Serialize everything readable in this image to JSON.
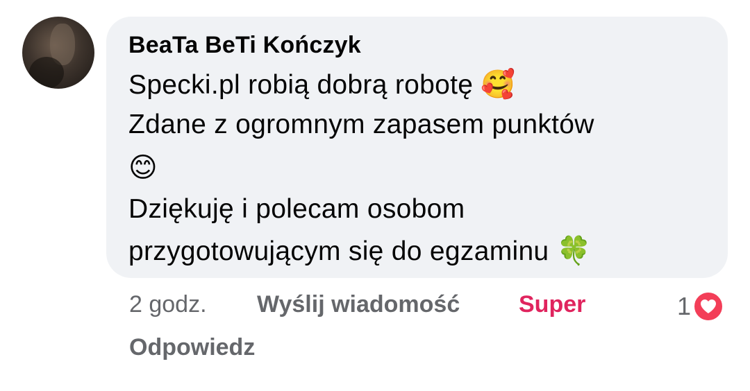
{
  "comment": {
    "author": "BeaTa BeTi Kończyk",
    "lines": [
      "Specki.pl  robią dobrą robotę",
      "Zdane z ogromnym zapasem punktów",
      "",
      "Dziękuję i polecam osobom",
      "przygotowującym się do egzaminu"
    ],
    "emojis": {
      "line1": "🥰",
      "line3": "😊",
      "line5": "🍀"
    }
  },
  "actions": {
    "time": "2 godz.",
    "send_message": "Wyślij wiadomość",
    "reaction_label": "Super",
    "reply": "Odpowiedz"
  },
  "reactions": {
    "count": "1",
    "icon": "heart-icon",
    "color": "#f33e58"
  },
  "colors": {
    "bubble": "#f0f2f5",
    "secondary_text": "#65676b",
    "super_accent": "#e0245e"
  }
}
